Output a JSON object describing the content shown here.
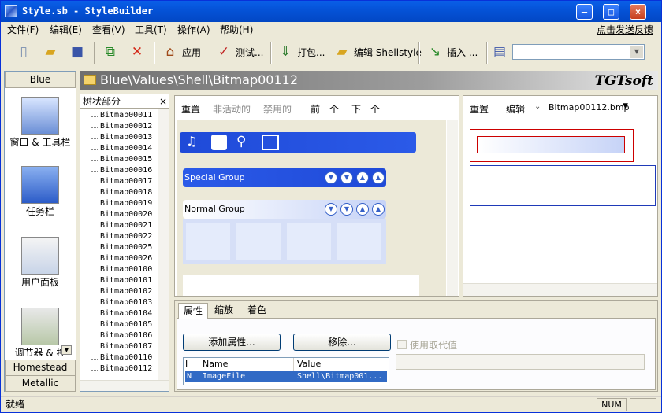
{
  "window": {
    "title": "Style.sb - StyleBuilder"
  },
  "menubar": {
    "items": [
      "文件(F)",
      "编辑(E)",
      "查看(V)",
      "工具(T)",
      "操作(A)",
      "帮助(H)"
    ],
    "feedback": "点击发送反馈"
  },
  "toolbar": {
    "apply": "应用",
    "test": "测试...",
    "pack": "打包...",
    "edit_shellstyle": "编辑 Shellstyle",
    "insert": "插入 ...",
    "combo_value": ""
  },
  "left_panel": {
    "top_header": "Blue",
    "items": [
      "窗口 & 工具栏",
      "任务栏",
      "用户面板",
      "调节器 & 控"
    ],
    "footer": [
      "Homestead",
      "Metallic"
    ]
  },
  "path_bar": {
    "path": "Blue\\Values\\Shell\\Bitmap00112",
    "logo": "TGTsoft"
  },
  "tree": {
    "title": "树状部分",
    "close": "×",
    "items": [
      "Bitmap00011",
      "Bitmap00012",
      "Bitmap00013",
      "Bitmap00014",
      "Bitmap00015",
      "Bitmap00016",
      "Bitmap00017",
      "Bitmap00018",
      "Bitmap00019",
      "Bitmap00020",
      "Bitmap00021",
      "Bitmap00022",
      "Bitmap00025",
      "Bitmap00026",
      "Bitmap00100",
      "Bitmap00101",
      "Bitmap00102",
      "Bitmap00103",
      "Bitmap00104",
      "Bitmap00105",
      "Bitmap00106",
      "Bitmap00107",
      "Bitmap00110",
      "Bitmap00112"
    ]
  },
  "preview": {
    "states": [
      "重置",
      "非活动的",
      "禁用的",
      "前一个",
      "下一个"
    ],
    "special_group": "Special Group",
    "normal_group": "Normal Group"
  },
  "right_preview": {
    "reset": "重置",
    "edit": "编辑",
    "file": "Bitmap00112.bmp"
  },
  "properties": {
    "tabs": [
      "属性",
      "缩放",
      "着色"
    ],
    "add_button": "添加属性...",
    "remove_button": "移除...",
    "use_substitute": "使用取代值",
    "columns": [
      "I",
      "Name",
      "Value"
    ],
    "rows": [
      {
        "i": "N",
        "name": "ImageFile",
        "value": "Shell\\Bitmap001..."
      }
    ]
  },
  "status": {
    "text": "就绪",
    "num": "NUM"
  },
  "colors": {
    "titlebar": "#0553d8",
    "selection": "#316ac5",
    "group": "#2b5ae8"
  }
}
